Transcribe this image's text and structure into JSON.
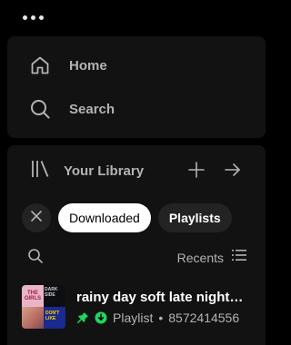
{
  "top": {
    "menu_icon": "more-dots-icon"
  },
  "nav": {
    "items": [
      {
        "label": "Home",
        "icon": "home-icon"
      },
      {
        "label": "Search",
        "icon": "search-icon"
      }
    ]
  },
  "library": {
    "title": "Your Library",
    "icon": "library-icon",
    "actions": [
      {
        "icon": "plus-icon"
      },
      {
        "icon": "arrow-right-icon"
      }
    ],
    "chips": [
      {
        "label": "Downloaded",
        "active": true
      },
      {
        "label": "Playlists",
        "active": false
      }
    ],
    "sort_label": "Recents",
    "items": [
      {
        "title": "rainy day soft late night…",
        "type": "Playlist",
        "separator": "•",
        "owner": "8572414556",
        "pinned": true,
        "downloaded": true
      }
    ]
  },
  "colors": {
    "accent": "#1ed760",
    "panel": "#121212",
    "chip_bg": "#232323",
    "muted_text": "#b3b3b3"
  }
}
